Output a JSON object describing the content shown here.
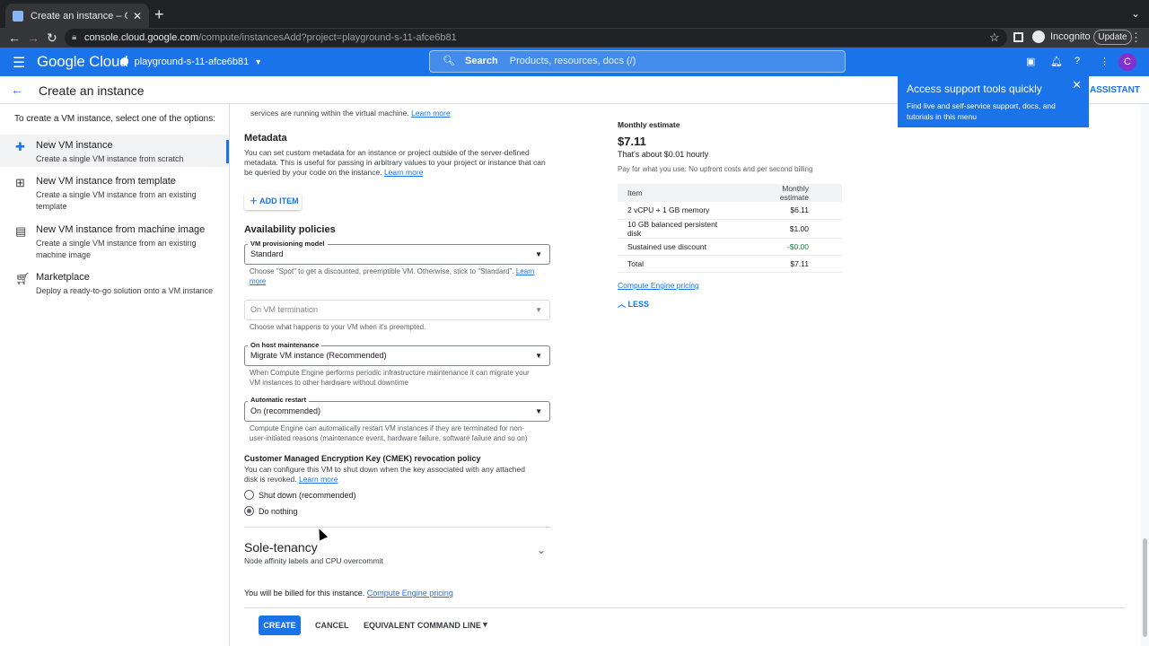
{
  "browser": {
    "tab_title": "Create an instance – Compute",
    "url_host": "console.cloud.google.com",
    "url_path": "/compute/instancesAdd?project=playground-s-11-afce6b81",
    "incognito_label": "Incognito",
    "update_label": "Update"
  },
  "gcp": {
    "logo": "Google Cloud",
    "project": "playground-s-11-afce6b81",
    "search_label": "Search",
    "search_placeholder": "Products, resources, docs (/)",
    "avatar_letter": "C"
  },
  "page": {
    "title": "Create an instance",
    "assistant_label": "ASSISTANT"
  },
  "left_panel": {
    "intro": "To create a VM instance, select one of the options:",
    "options": [
      {
        "title": "New VM instance",
        "desc": "Create a single VM instance from scratch"
      },
      {
        "title": "New VM instance from template",
        "desc": "Create a single VM instance from an existing template"
      },
      {
        "title": "New VM instance from machine image",
        "desc": "Create a single VM instance from an existing machine image"
      },
      {
        "title": "Marketplace",
        "desc": "Deploy a ready-to-go solution onto a VM instance"
      }
    ]
  },
  "main": {
    "top_text": "services are running within the virtual machine.",
    "learn_more": "Learn more",
    "metadata_title": "Metadata",
    "metadata_desc": "You can set custom metadata for an instance or project outside of the server-defined metadata. This is useful for passing in arbitrary values to your project or instance that can be queried by your code on the instance.",
    "add_item": "ADD ITEM",
    "availability_title": "Availability policies",
    "provisioning_label": "VM provisioning model",
    "provisioning_value": "Standard",
    "provisioning_help": "Choose \"Spot\" to get a discounted, preemptible VM. Otherwise, stick to \"Standard\".",
    "learn_more_short": "Learn more",
    "termination_placeholder": "On VM termination",
    "termination_help": "Choose what happens to your VM when it's preempted.",
    "host_label": "On host maintenance",
    "host_value": "Migrate VM instance (Recommended)",
    "host_help": "When Compute Engine performs periodic infrastructure maintenance it can migrate your VM instances to other hardware without downtime",
    "restart_label": "Automatic restart",
    "restart_value": "On (recommended)",
    "restart_help": "Compute Engine can automatically restart VM instances if they are terminated for non-user-initiated reasons (maintenance event, hardware failure, software failure and so on)",
    "cmek_title": "Customer Managed Encryption Key (CMEK) revocation policy",
    "cmek_desc": "You can configure this VM to shut down when the key associated with any attached disk is revoked.",
    "radio_shutdown": "Shut down (recommended)",
    "radio_nothing": "Do nothing",
    "sole_title": "Sole-tenancy",
    "sole_sub": "Node affinity labels and CPU overcommit",
    "billed_text": "You will be billed for this instance.",
    "billed_link": "Compute Engine pricing"
  },
  "footer": {
    "create": "CREATE",
    "cancel": "CANCEL",
    "equivalent": "EQUIVALENT COMMAND LINE"
  },
  "estimate": {
    "heading": "Monthly estimate",
    "price": "$7.11",
    "hourly": "That's about $0.01 hourly",
    "pay_note": "Pay for what you use: No upfront costs and per second billing",
    "col_item": "Item",
    "col_estimate": "Monthly estimate",
    "rows": [
      {
        "item": "2 vCPU + 1 GB memory",
        "cost": "$6.11"
      },
      {
        "item": "10 GB balanced persistent disk",
        "cost": "$1.00"
      },
      {
        "item": "Sustained use discount",
        "cost": "-$0.00"
      },
      {
        "item": "Total",
        "cost": "$7.11"
      }
    ],
    "pricing_link": "Compute Engine pricing",
    "less": "LESS"
  },
  "tooltip": {
    "title": "Access support tools quickly",
    "desc": "Find live and self-service support, docs, and tutorials in this menu"
  },
  "colors": {
    "brand_blue": "#1a73e8",
    "discount_green": "#188038"
  }
}
